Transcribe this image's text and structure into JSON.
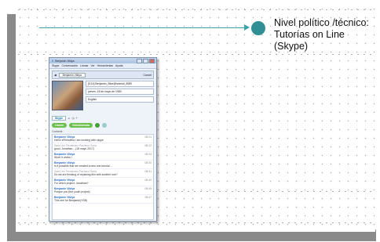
{
  "slide": {
    "heading_lines": [
      "Nivel político /técnico:",
      "Tutorías on Line",
      "(Skype)"
    ]
  },
  "colors": {
    "accent": "#3aa3a9",
    "bullet": "#2f8e96",
    "frame_gray": "#8a8a8a",
    "skype_green": "#6cbf4a"
  },
  "skype": {
    "title": "Benjamin Viktya",
    "menu": [
      "Skype",
      "Conversación",
      "Llamar",
      "Ver",
      "Herramientas",
      "Ayuda"
    ],
    "toolbar_user": "Benjamin Viktya",
    "toolbar_cancel": "Cancel",
    "profile_fields": [
      "[5:14] Benjamin_Blue@hotmail_8080",
      "jueves, 18 de mayo de 1980",
      "English"
    ],
    "tabs": [
      "Skype"
    ],
    "call_button": "Llamar",
    "video_button": "Videollamada",
    "contacts_label": "Contacts",
    "messages": [
      {
        "from": "Benjamin Viktya",
        "time": "08:21",
        "body": "Hello! #Rhinoffea I am working with skype",
        "gray": false
      },
      {
        "from": "Sara Lee Fernandez Pacheco Soria",
        "time": "08:22",
        "body": "good, Jonathan ...(18 mayo 2017)",
        "gray": true
      },
      {
        "from": "Benjamin Viktya",
        "time": "08:24",
        "body": "Wow! it works !",
        "gray": false
      },
      {
        "from": "Benjamin Viktya",
        "time": "08:30",
        "body": "Is it possible that we created a new one tutorial ...",
        "gray": false
      },
      {
        "from": "Sara Lee Fernandez Pacheco Soria",
        "time": "08:31",
        "body": "Do we are thinking of replacing this with another one?",
        "gray": true
      },
      {
        "from": "Benjamin Viktya",
        "time": "08:40",
        "body": "For which project, Jonathan?",
        "gray": false
      },
      {
        "from": "Benjamin Viktya",
        "time": "08:45",
        "body": "Porque you (the youth project)",
        "gray": false
      },
      {
        "from": "Benjamin Viktya",
        "time": "08:47",
        "body": "This one for Benjamin(YSB)",
        "gray": false
      }
    ]
  }
}
